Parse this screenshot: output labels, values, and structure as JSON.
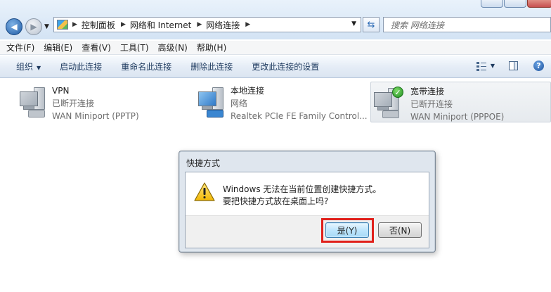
{
  "address_bar": {
    "crumbs": [
      "控制面板",
      "网络和 Internet",
      "网络连接"
    ],
    "search_placeholder": "搜索 网络连接"
  },
  "menu": [
    "文件(F)",
    "编辑(E)",
    "查看(V)",
    "工具(T)",
    "高级(N)",
    "帮助(H)"
  ],
  "toolbar": {
    "organize": "组织",
    "items": [
      "启动此连接",
      "重命名此连接",
      "删除此连接",
      "更改此连接的设置"
    ],
    "help": "?"
  },
  "connections": [
    {
      "name": "VPN",
      "status": "已断开连接",
      "device": "WAN Miniport (PPTP)",
      "icon": "vpn-computer-icon"
    },
    {
      "name": "本地连接",
      "status": "网络",
      "device": "Realtek PCIe FE Family Control...",
      "icon": "ethernet-computer-icon"
    },
    {
      "name": "宽带连接",
      "status": "已断开连接",
      "device": "WAN Miniport (PPPOE)",
      "icon": "broadband-computer-icon",
      "selected": true
    }
  ],
  "dialog": {
    "title": "快捷方式",
    "message_line1": "Windows 无法在当前位置创建快捷方式。",
    "message_line2": "要把快捷方式放在桌面上吗?",
    "yes_label": "是(Y)",
    "no_label": "否(N)",
    "highlight_color": "#e0201b"
  }
}
